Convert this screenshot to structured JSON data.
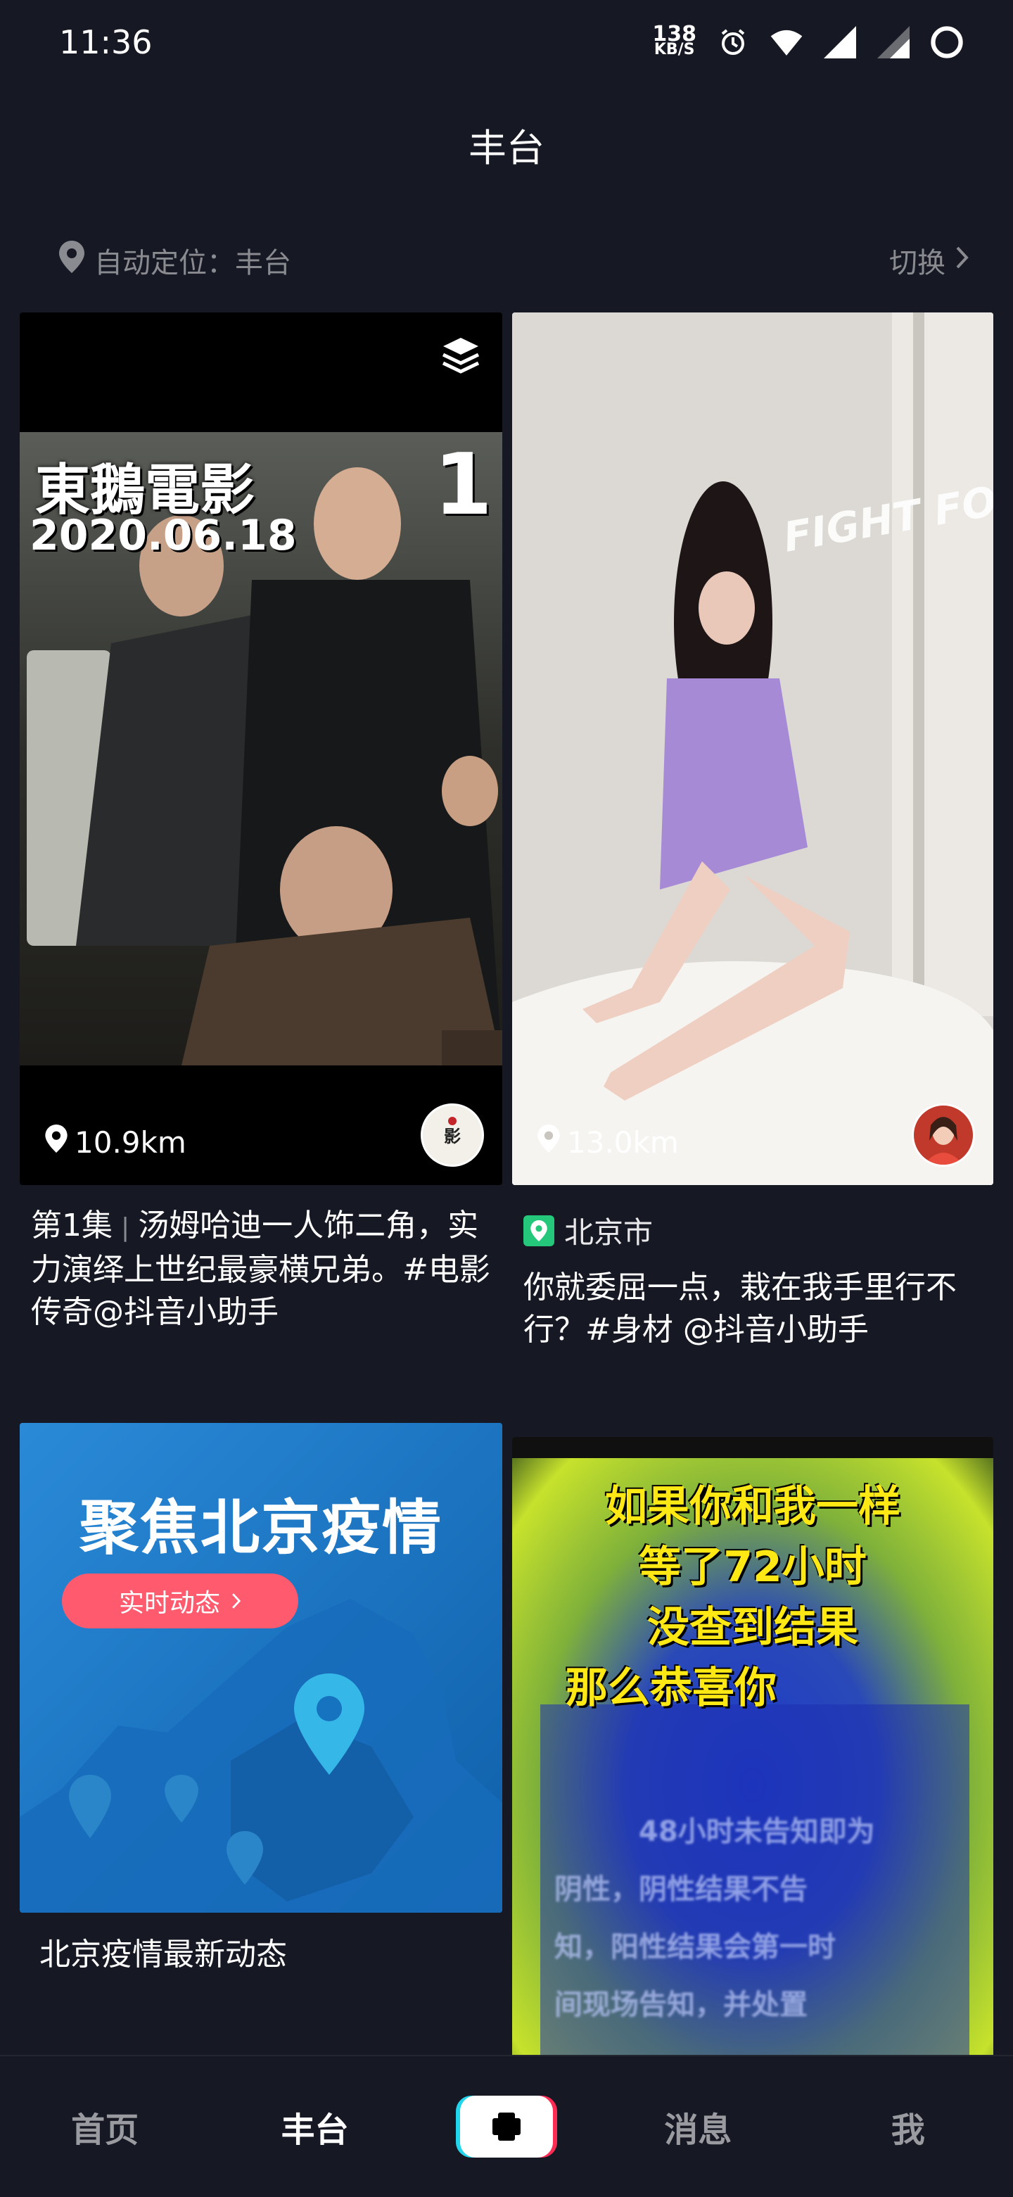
{
  "status_bar": {
    "time": "11:36",
    "net_speed": "138",
    "net_unit": "KB/S"
  },
  "header": {
    "title": "丰台"
  },
  "location": {
    "auto_label": "自动定位：丰台",
    "switch_label": "切换"
  },
  "feed": [
    {
      "distance": "10.9km",
      "overlay_title": "東鵝電影",
      "overlay_date": "2020.06.18",
      "overlay_number": "1",
      "caption_ep": "第1集",
      "caption_text": "汤姆哈迪一人饰二角，实力演绎上世纪最豪横兄弟。#电影传奇@抖音小助手"
    },
    {
      "distance": "13.0km",
      "place": "北京市",
      "overlay_text": "FIGHT FOR YOU RIGHT!",
      "caption_text": "你就委屈一点，栽在我手里行不行？#身材 @抖音小助手"
    },
    {
      "banner_title": "聚焦北京疫情",
      "banner_button": "实时动态",
      "caption_text": "北京疫情最新动态"
    },
    {
      "overlay_line1": "如果你和我一样",
      "overlay_line2": "等了72小时",
      "overlay_line3": "没查到结果",
      "overlay_line4": "那么恭喜你",
      "blur_line1": "48小时未告知即为",
      "blur_line2": "阴性，阴性结果不告",
      "blur_line3": "知，阳性结果会第一时",
      "blur_line4": "间现场告知，并处置"
    }
  ],
  "tabs": [
    {
      "label": "首页"
    },
    {
      "label": "丰台"
    },
    {
      "label": "消息"
    },
    {
      "label": "我"
    }
  ],
  "colors": {
    "background": "#161823",
    "muted_text": "#8a8b91",
    "plus_cyan": "#20d5ec",
    "plus_red": "#fe2c55",
    "banner_blue": "#1b78c8",
    "banner_pill": "#ff5a6e"
  }
}
